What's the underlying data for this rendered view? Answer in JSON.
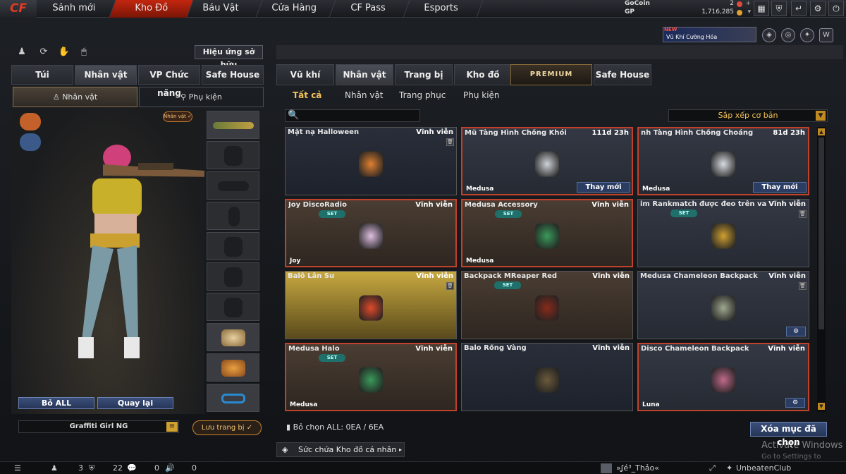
{
  "topbar": {
    "logo": "CF",
    "tabs": [
      "Sảnh mới",
      "Kho Đồ",
      "Báu Vật",
      "Cửa Hàng",
      "CF Pass",
      "Esports"
    ],
    "active_tab": 1,
    "currency": {
      "gocoin_label": "GoCoin",
      "gocoin_value": "2",
      "gp_label": "GP",
      "gp_value": "1,716,285"
    }
  },
  "promo": {
    "new_label": "NEW",
    "text": "Vũ Khí Cường Hóa"
  },
  "left": {
    "effect_button": "Hiệu ứng sở hữu",
    "tabs": [
      "Túi",
      "Nhân vật",
      "VP Chức năng",
      "Safe House"
    ],
    "subtabs": [
      "Nhân vật",
      "Phụ kiện"
    ],
    "character_badge": "Nhân vật ✓",
    "remove_all_button": "Bỏ ALL",
    "back_button": "Quay lại",
    "preset_name": "Graffiti Girl NG",
    "save_button": "Lưu trang bị"
  },
  "right": {
    "tabs": [
      "Vũ khí",
      "Nhân vật",
      "Trang bị",
      "Kho đồ",
      "PREMIUM",
      "Safe House"
    ],
    "filters": [
      "Tất cả",
      "Nhân vật",
      "Trang phục",
      "Phụ kiện"
    ],
    "sort_label": "Sắp xếp cơ bản",
    "items": [
      {
        "name": "Mặt nạ Halloween",
        "duration": "Vĩnh viễn",
        "set": "",
        "bottom": "",
        "trash": true,
        "replace": "",
        "gear": false
      },
      {
        "name": "Mũ Tàng Hình Chống Khói",
        "duration": "111d 23h",
        "set": "",
        "bottom": "Medusa",
        "trash": false,
        "replace": "Thay mới",
        "gear": false
      },
      {
        "name": "nh Tàng Hình Chống Choáng",
        "duration": "81d 23h",
        "set": "",
        "bottom": "Medusa",
        "trash": false,
        "replace": "Thay mới",
        "gear": false
      },
      {
        "name": "Joy DiscoRadio",
        "duration": "Vĩnh viễn",
        "set": "SET",
        "bottom": "Joy",
        "trash": false,
        "replace": "",
        "gear": false
      },
      {
        "name": "Medusa Accessory",
        "duration": "Vĩnh viễn",
        "set": "SET",
        "bottom": "Medusa",
        "trash": false,
        "replace": "",
        "gear": false
      },
      {
        "name": "im Rankmatch được đeo trên vai",
        "duration": "Vĩnh viễn",
        "set": "SET",
        "bottom": "",
        "trash": true,
        "replace": "",
        "gear": false
      },
      {
        "name": "Balô Lân Sư",
        "duration": "Vĩnh viễn",
        "set": "",
        "bottom": "",
        "trash": true,
        "replace": "",
        "gear": false
      },
      {
        "name": "Backpack MReaper Red",
        "duration": "Vĩnh viễn",
        "set": "SET",
        "bottom": "",
        "trash": false,
        "replace": "",
        "gear": false
      },
      {
        "name": "Medusa Chameleon Backpack",
        "duration": "Vĩnh viễn",
        "set": "",
        "bottom": "",
        "trash": true,
        "replace": "",
        "gear": true
      },
      {
        "name": "Medusa Halo",
        "duration": "Vĩnh viễn",
        "set": "SET",
        "bottom": "Medusa",
        "trash": false,
        "replace": "",
        "gear": false
      },
      {
        "name": "Balo Rồng Vàng",
        "duration": "Vĩnh viễn",
        "set": "",
        "bottom": "",
        "trash": false,
        "replace": "",
        "gear": false
      },
      {
        "name": "Disco Chameleon Backpack",
        "duration": "Vĩnh viễn",
        "set": "",
        "bottom": "Luna",
        "trash": false,
        "replace": "",
        "gear": true
      }
    ],
    "selection_info": "Bỏ chọn ALL: 0EA / 6EA",
    "delete_button": "Xóa mục đã chọn",
    "capacity_label": "Sức chứa Kho đồ cá nhân"
  },
  "bottombar": {
    "count1": "3",
    "count2": "22",
    "count3": "0",
    "count4": "0",
    "user_name": "»ʆé³_Thảo«",
    "clan_name": "UnbeatenClub"
  },
  "watermark": {
    "line1": "Activate Windows",
    "line2": "Go to Settings to activate Windows."
  }
}
